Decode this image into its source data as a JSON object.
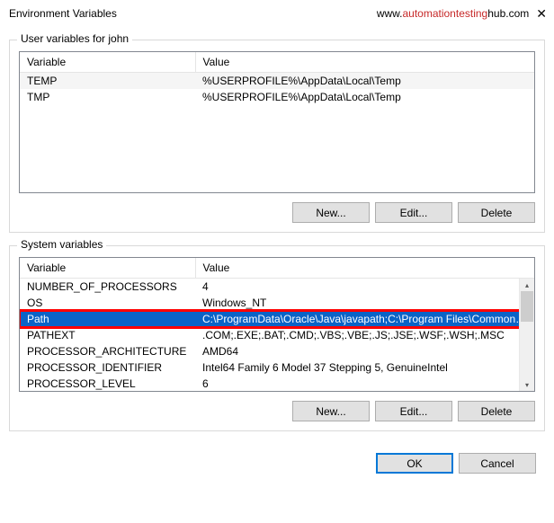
{
  "window": {
    "title": "Environment Variables",
    "watermark_prefix": "www.",
    "watermark_mid": "automationtesting",
    "watermark_suffix": "hub",
    "watermark_end": ".com"
  },
  "user_section": {
    "legend": "User variables for john",
    "headers": {
      "var": "Variable",
      "val": "Value"
    },
    "rows": [
      {
        "var": "TEMP",
        "val": "%USERPROFILE%\\AppData\\Local\\Temp"
      },
      {
        "var": "TMP",
        "val": "%USERPROFILE%\\AppData\\Local\\Temp"
      }
    ],
    "buttons": {
      "new": "New...",
      "edit": "Edit...",
      "delete": "Delete"
    }
  },
  "system_section": {
    "legend": "System variables",
    "headers": {
      "var": "Variable",
      "val": "Value"
    },
    "rows": [
      {
        "var": "NUMBER_OF_PROCESSORS",
        "val": "4"
      },
      {
        "var": "OS",
        "val": "Windows_NT"
      },
      {
        "var": "Path",
        "val": "C:\\ProgramData\\Oracle\\Java\\javapath;C:\\Program Files\\Common ..."
      },
      {
        "var": "PATHEXT",
        "val": ".COM;.EXE;.BAT;.CMD;.VBS;.VBE;.JS;.JSE;.WSF;.WSH;.MSC"
      },
      {
        "var": "PROCESSOR_ARCHITECTURE",
        "val": "AMD64"
      },
      {
        "var": "PROCESSOR_IDENTIFIER",
        "val": "Intel64 Family 6 Model 37 Stepping 5, GenuineIntel"
      },
      {
        "var": "PROCESSOR_LEVEL",
        "val": "6"
      }
    ],
    "selected_index": 2,
    "buttons": {
      "new": "New...",
      "edit": "Edit...",
      "delete": "Delete"
    }
  },
  "dialog_buttons": {
    "ok": "OK",
    "cancel": "Cancel"
  }
}
